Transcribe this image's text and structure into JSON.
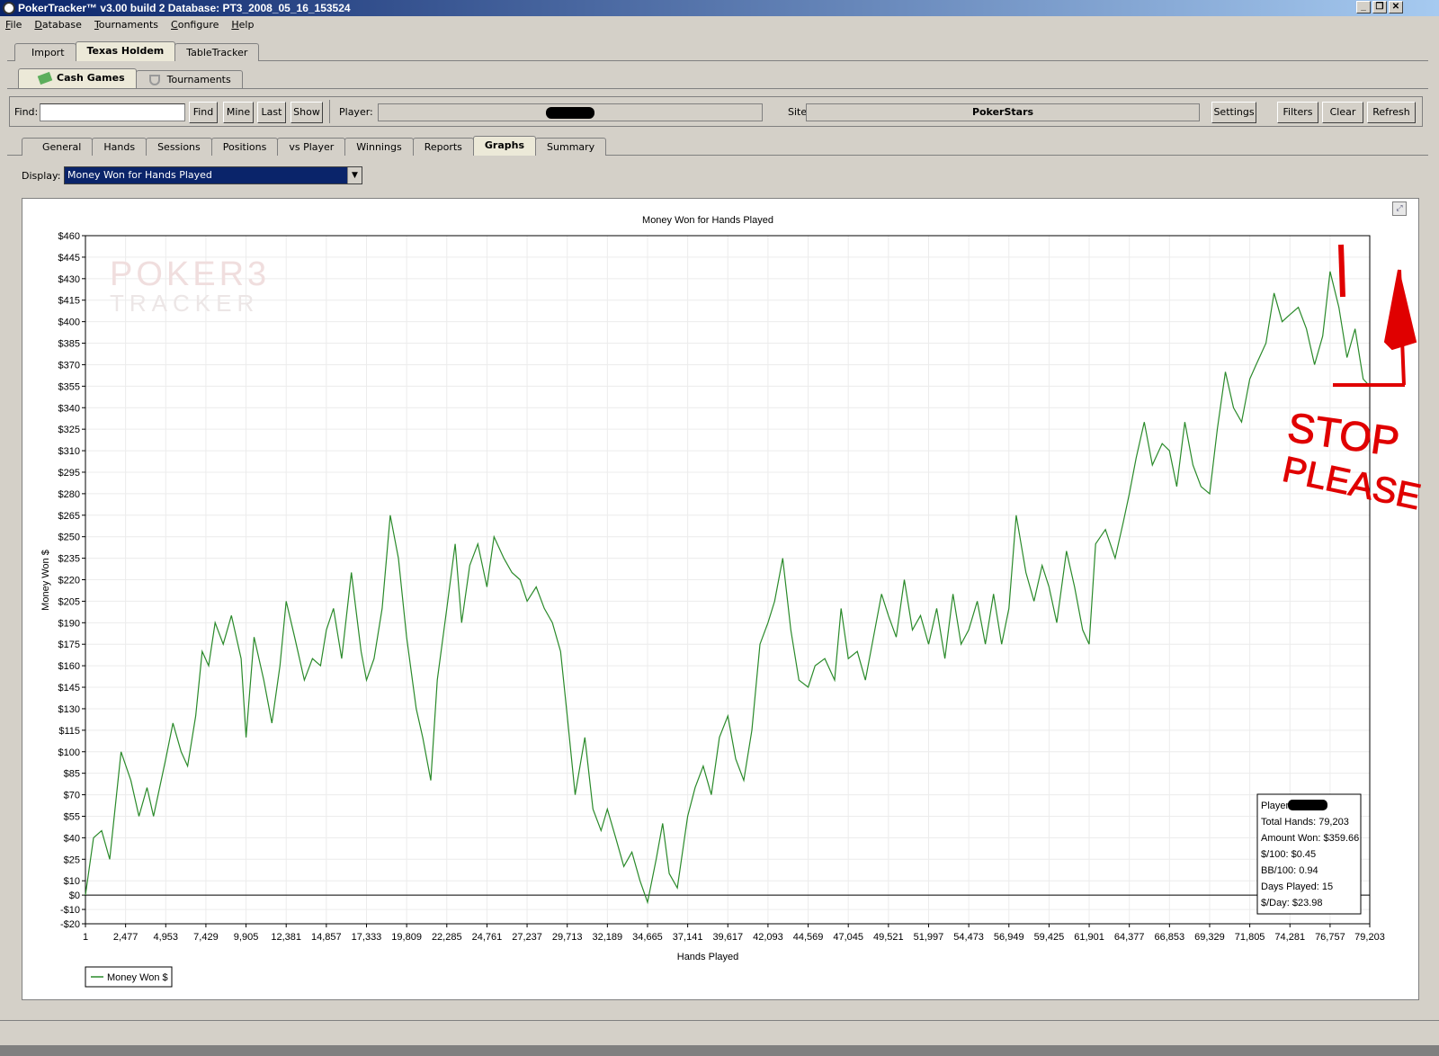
{
  "window": {
    "title": "PokerTracker™ v3.00 build 2  Database: PT3_2008_05_16_153524"
  },
  "menu": [
    "File",
    "Database",
    "Tournaments",
    "Configure",
    "Help"
  ],
  "top_tabs": [
    "Import",
    "Texas Holdem",
    "TableTracker"
  ],
  "sub_tabs": [
    "Cash Games",
    "Tournaments"
  ],
  "toolbar": {
    "find_label": "Find:",
    "find_value": "",
    "find_button": "Find",
    "mine_button": "Mine",
    "last_button": "Last",
    "show_button": "Show",
    "player_label": "Player:",
    "site_label": "Site:",
    "site_value": "PokerStars",
    "settings_button": "Settings",
    "filters_button": "Filters",
    "clear_button": "Clear",
    "refresh_button": "Refresh"
  },
  "report_tabs": [
    "General",
    "Hands",
    "Sessions",
    "Positions",
    "vs Player",
    "Winnings",
    "Reports",
    "Graphs",
    "Summary"
  ],
  "active_report_tab": "Graphs",
  "display": {
    "label": "Display:",
    "value": "Money Won for Hands Played"
  },
  "watermark": {
    "line1": "POKER3",
    "line2": "TRACKER"
  },
  "stats_box": [
    "Player:",
    "Total Hands: 79,203",
    "Amount Won: $359.66",
    "$/100: $0.45",
    "BB/100: 0.94",
    "Days Played: 15",
    "$/Day: $23.98"
  ],
  "annotation": {
    "line1": "STOP",
    "line2": "PLEASE",
    "color": "#e00000"
  },
  "chart_data": {
    "type": "line",
    "title": "Money Won for Hands Played",
    "xlabel": "Hands Played",
    "ylabel": "Money Won $",
    "xlim": [
      1,
      79203
    ],
    "ylim": [
      -20,
      460
    ],
    "x_ticks": [
      "1",
      "2,477",
      "4,953",
      "7,429",
      "9,905",
      "12,381",
      "14,857",
      "17,333",
      "19,809",
      "22,285",
      "24,761",
      "27,237",
      "29,713",
      "32,189",
      "34,665",
      "37,141",
      "39,617",
      "42,093",
      "44,569",
      "47,045",
      "49,521",
      "51,997",
      "54,473",
      "56,949",
      "59,425",
      "61,901",
      "64,377",
      "66,853",
      "69,329",
      "71,805",
      "74,281",
      "76,757",
      "79,203"
    ],
    "y_ticks": [
      "$460",
      "$445",
      "$430",
      "$415",
      "$400",
      "$385",
      "$370",
      "$355",
      "$340",
      "$325",
      "$310",
      "$295",
      "$280",
      "$265",
      "$250",
      "$235",
      "$220",
      "$205",
      "$190",
      "$175",
      "$160",
      "$145",
      "$130",
      "$115",
      "$100",
      "$85",
      "$70",
      "$55",
      "$40",
      "$25",
      "$10",
      "$0",
      "-$10",
      "-$20"
    ],
    "grid": true,
    "legend": "bottom-left",
    "series": [
      {
        "name": "Money Won $",
        "color": "#2a8a2a",
        "x": [
          1,
          500,
          1000,
          1500,
          2200,
          2800,
          3300,
          3800,
          4200,
          4953,
          5400,
          5900,
          6300,
          6800,
          7200,
          7600,
          8000,
          8500,
          9000,
          9600,
          9905,
          10400,
          11000,
          11500,
          12000,
          12381,
          12900,
          13500,
          14000,
          14500,
          14857,
          15300,
          15800,
          16400,
          17000,
          17333,
          17800,
          18300,
          18800,
          19300,
          19809,
          20400,
          20800,
          21300,
          21700,
          22285,
          22800,
          23200,
          23700,
          24200,
          24761,
          25200,
          25800,
          26300,
          26800,
          27237,
          27800,
          28300,
          28800,
          29300,
          29713,
          30200,
          30800,
          31300,
          31800,
          32189,
          32700,
          33200,
          33700,
          34200,
          34665,
          35200,
          35600,
          36000,
          36500,
          37141,
          37600,
          38100,
          38600,
          39100,
          39617,
          40100,
          40600,
          41100,
          41600,
          42093,
          42500,
          43000,
          43500,
          44000,
          44569,
          45000,
          45600,
          46200,
          46600,
          47045,
          47600,
          48100,
          48600,
          49100,
          49521,
          50000,
          50500,
          51000,
          51500,
          51997,
          52500,
          53000,
          53500,
          54000,
          54473,
          55000,
          55500,
          56000,
          56500,
          56949,
          57400,
          58000,
          58500,
          59000,
          59425,
          59900,
          60500,
          61000,
          61500,
          61901,
          62300,
          62900,
          63500,
          64000,
          64377,
          64800,
          65300,
          65800,
          66400,
          66853,
          67300,
          67800,
          68300,
          68800,
          69329,
          69800,
          70300,
          70800,
          71300,
          71805,
          72200,
          72800,
          73300,
          73800,
          74281,
          74800,
          75300,
          75800,
          76300,
          76757,
          77300,
          77800,
          78300,
          78800,
          79203
        ],
        "values": [
          0,
          40,
          45,
          25,
          100,
          80,
          55,
          75,
          55,
          95,
          120,
          100,
          90,
          125,
          170,
          160,
          190,
          175,
          195,
          165,
          110,
          180,
          150,
          120,
          160,
          205,
          180,
          150,
          165,
          160,
          185,
          200,
          165,
          225,
          170,
          150,
          165,
          200,
          265,
          235,
          180,
          130,
          110,
          80,
          150,
          200,
          245,
          190,
          230,
          245,
          215,
          250,
          235,
          225,
          220,
          205,
          215,
          200,
          190,
          170,
          125,
          70,
          110,
          60,
          45,
          60,
          40,
          20,
          30,
          10,
          -5,
          25,
          50,
          15,
          5,
          55,
          75,
          90,
          70,
          110,
          125,
          95,
          80,
          115,
          175,
          190,
          205,
          235,
          185,
          150,
          145,
          160,
          165,
          150,
          200,
          165,
          170,
          150,
          180,
          210,
          195,
          180,
          220,
          185,
          195,
          175,
          200,
          165,
          210,
          175,
          185,
          205,
          175,
          210,
          175,
          200,
          265,
          225,
          205,
          230,
          215,
          190,
          240,
          215,
          185,
          175,
          245,
          255,
          235,
          260,
          280,
          305,
          330,
          300,
          315,
          310,
          285,
          330,
          300,
          285,
          280,
          325,
          365,
          340,
          330,
          360,
          370,
          385,
          420,
          400,
          405,
          410,
          395,
          370,
          390,
          435,
          410,
          375,
          395,
          360,
          355
        ]
      }
    ]
  }
}
